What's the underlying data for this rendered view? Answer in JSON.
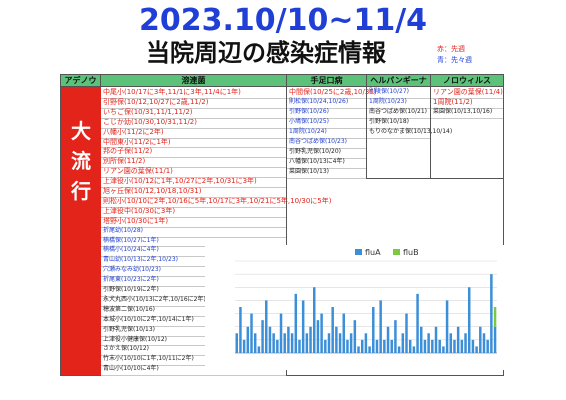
{
  "header": {
    "title": "2023.10/10~11/4",
    "subtitle": "当院周辺の感染症情報",
    "legend": [
      "赤：先週",
      "青：先々週"
    ]
  },
  "columns": [
    {
      "label": "アデノウィルス"
    },
    {
      "label": "溶連菌"
    },
    {
      "label": "手足口病"
    },
    {
      "label": "ヘルパンギーナ"
    },
    {
      "label": "ノロウィルス"
    }
  ],
  "adeno_big_label": [
    "大",
    "流",
    "行"
  ],
  "strep_entries": [
    {
      "text": "中尾小(10/17に3年,11/1に3年,11/4に1年)",
      "color": "red"
    },
    {
      "text": "引野保(10/12,10/27に2歳,11/2)",
      "color": "red"
    },
    {
      "text": "いちご保(10/31,11/1,11/2)",
      "color": "red"
    },
    {
      "text": "こじか幼(10/30,10/31,11/2)",
      "color": "red"
    },
    {
      "text": "八幡小(11/2に2年)",
      "color": "red"
    },
    {
      "text": "中間東小(11/2に1年)",
      "color": "red"
    },
    {
      "text": "邦の子保(11/2)",
      "color": "red"
    },
    {
      "text": "別所保(11/2)",
      "color": "red"
    },
    {
      "text": "リアン園の葉保(11/1)",
      "color": "red"
    },
    {
      "text": "上津役小(10/12に1年,10/27に2年,10/31に3年)",
      "color": "red"
    },
    {
      "text": "旭ヶ丘保(10/12,10/18,10/31)",
      "color": "red"
    },
    {
      "text": "則松小(10/10に2年,10/16に5年,10/17に3年,10/21に5年,10/30に5年)",
      "color": "red"
    },
    {
      "text": "上津役中(10/30に3年)",
      "color": "red"
    },
    {
      "text": "塔野小(10/30に1年)",
      "color": "red"
    },
    {
      "text": "折尾幼(10/28)",
      "color": "blue"
    },
    {
      "text": "楠橋保(10/27に1年)",
      "color": "blue"
    },
    {
      "text": "楠橋小(10/24に4年)",
      "color": "blue"
    },
    {
      "text": "青山幼(10/13に2年,10/23)",
      "color": "blue"
    },
    {
      "text": "穴瀬みなみ幼(10/23)",
      "color": "blue"
    },
    {
      "text": "折尾東(10/23に2年)",
      "color": "blue"
    },
    {
      "text": "引野保(10/19に2年)",
      "color": "black"
    },
    {
      "text": "永犬丸西小(10/13に2年,10/16に2年)",
      "color": "black"
    },
    {
      "text": "穂波第二保(10/16)",
      "color": "black"
    },
    {
      "text": "本城小(10/10に2年,10/14に1年)",
      "color": "black"
    },
    {
      "text": "引野乳児保(10/13)",
      "color": "black"
    },
    {
      "text": "上津役小健康保(10/12)",
      "color": "black"
    },
    {
      "text": "さかえ保(10/12)",
      "color": "black"
    },
    {
      "text": "竹末小(10/10に1年,10/11に2年)",
      "color": "black"
    },
    {
      "text": "青山小(10/10に4年)",
      "color": "black"
    }
  ],
  "hfmd_entries": [
    {
      "text": "中間保(10/25に2歳,10/30)",
      "color": "red"
    },
    {
      "text": "則松保(10/24,10/26)",
      "color": "blue"
    },
    {
      "text": "引野保(10/26)",
      "color": "blue"
    },
    {
      "text": "小鳩保(10/25)",
      "color": "blue"
    },
    {
      "text": "1周院(10/24)",
      "color": "blue"
    },
    {
      "text": "南谷つばめ保(10/23)",
      "color": "blue"
    },
    {
      "text": "引野乳児保(10/20)",
      "color": "black"
    },
    {
      "text": "八幡保(10/13に4年)",
      "color": "black"
    },
    {
      "text": "菜園保(10/13)",
      "color": "black"
    }
  ],
  "herpangina_entries": [
    {
      "text": "則陵保(10/27)",
      "color": "blue"
    },
    {
      "text": "1周院(10/23)",
      "color": "blue"
    },
    {
      "text": "南谷つばめ保(10/21)",
      "color": "black"
    },
    {
      "text": "引野保(10/18)",
      "color": "black"
    },
    {
      "text": "もりのなかま保(10/13,10/14)",
      "color": "black"
    }
  ],
  "noro_entries": [
    {
      "text": "リアン園の葉保(11/4)",
      "color": "red"
    },
    {
      "text": "1周院(11/2)",
      "color": "red"
    },
    {
      "text": "菜園保(10/13,10/16)",
      "color": "black"
    }
  ],
  "colors": {
    "red": "#e3241b",
    "blue": "#1f3fd6",
    "header_green": "#5cc27a",
    "fluA": "#3b8fd9",
    "fluB": "#7ac943"
  },
  "chart_data": {
    "type": "bar",
    "series": [
      {
        "name": "fluA",
        "values": [
          3,
          7,
          2,
          4,
          6,
          3,
          1,
          5,
          8,
          4,
          3,
          2,
          6,
          3,
          4,
          3,
          9,
          2,
          8,
          3,
          4,
          10,
          5,
          6,
          2,
          3,
          7,
          4,
          3,
          6,
          2,
          3,
          5,
          1,
          2,
          3,
          1,
          7,
          2,
          8,
          2,
          4,
          2,
          5,
          1,
          3,
          6,
          2,
          1,
          9,
          4,
          2,
          3,
          2,
          4,
          2,
          1,
          8,
          3,
          2,
          4,
          2,
          3,
          10,
          2,
          1,
          4,
          3,
          2,
          12,
          4
        ]
      },
      {
        "name": "fluB",
        "values": [
          0,
          0,
          0,
          0,
          0,
          0,
          0,
          0,
          0,
          0,
          0,
          0,
          0,
          0,
          0,
          0,
          0,
          0,
          0,
          0,
          0,
          0,
          0,
          0,
          0,
          0,
          0,
          0,
          0,
          0,
          0,
          0,
          0,
          0,
          0,
          0,
          0,
          0,
          0,
          0,
          0,
          0,
          0,
          0,
          0,
          0,
          0,
          0,
          0,
          0,
          0,
          0,
          0,
          0,
          0,
          0,
          0,
          0,
          0,
          0,
          0,
          0,
          0,
          0,
          0,
          0,
          0,
          0,
          0,
          0,
          3
        ]
      }
    ],
    "ylim": [
      0,
      14
    ]
  }
}
